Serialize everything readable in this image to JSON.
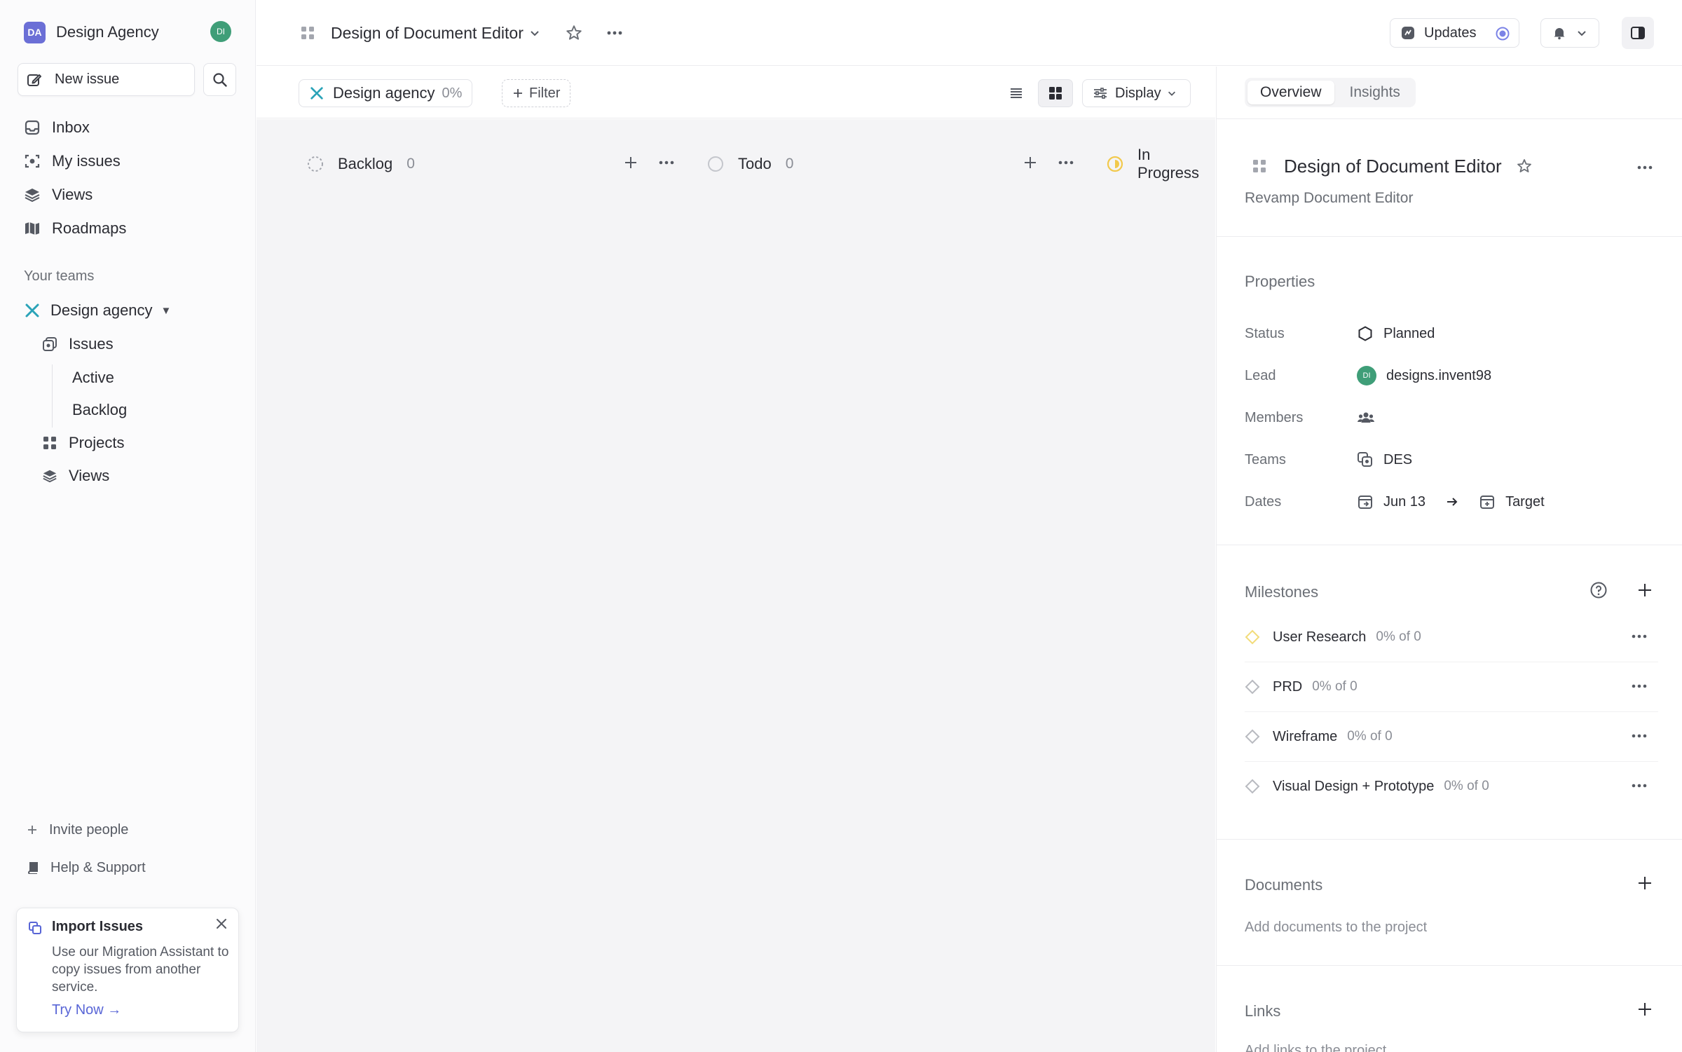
{
  "workspace": {
    "initials": "DA",
    "name": "Design Agency",
    "user_initials": "DI"
  },
  "sidebar": {
    "new_issue": "New issue",
    "nav": [
      {
        "label": "Inbox"
      },
      {
        "label": "My issues"
      },
      {
        "label": "Views"
      },
      {
        "label": "Roadmaps"
      }
    ],
    "teams_label": "Your teams",
    "team": {
      "name": "Design agency"
    },
    "team_items": {
      "issues": "Issues",
      "active": "Active",
      "backlog": "Backlog",
      "projects": "Projects",
      "views": "Views"
    },
    "invite": "Invite people",
    "help": "Help & Support"
  },
  "import_card": {
    "title": "Import Issues",
    "body": "Use our Migration Assistant to copy issues from another service.",
    "link": "Try Now →"
  },
  "topbar": {
    "project_title": "Design of Document Editor",
    "updates": "Updates"
  },
  "filterbar": {
    "team_chip": "Design agency",
    "team_pct": "0%",
    "filter": "Filter",
    "display": "Display"
  },
  "board": {
    "columns": [
      {
        "name": "Backlog",
        "count": "0"
      },
      {
        "name": "Todo",
        "count": "0"
      },
      {
        "name": "In Progress",
        "count": ""
      }
    ]
  },
  "panel": {
    "tabs": [
      {
        "label": "Overview"
      },
      {
        "label": "Insights"
      }
    ],
    "title": "Design of Document Editor",
    "description": "Revamp Document Editor",
    "properties_label": "Properties",
    "properties": {
      "status": {
        "key": "Status",
        "value": "Planned"
      },
      "lead": {
        "key": "Lead",
        "initials": "DI",
        "value": "designs.invent98"
      },
      "members": {
        "key": "Members"
      },
      "teams": {
        "key": "Teams",
        "value": "DES"
      },
      "dates": {
        "key": "Dates",
        "start": "Jun 13",
        "target": "Target"
      }
    },
    "milestones_label": "Milestones",
    "milestones": [
      {
        "name": "User Research",
        "progress": "0% of 0"
      },
      {
        "name": "PRD",
        "progress": "0% of 0"
      },
      {
        "name": "Wireframe",
        "progress": "0% of 0"
      },
      {
        "name": "Visual Design + Prototype",
        "progress": "0% of 0"
      }
    ],
    "documents_label": "Documents",
    "documents_hint": "Add documents to the project",
    "links_label": "Links",
    "links_hint": "Add links to the project"
  },
  "colors": {
    "accent": "#5865d6",
    "status_progress": "#f2c94c",
    "lead_avatar": "#3f9e78"
  }
}
